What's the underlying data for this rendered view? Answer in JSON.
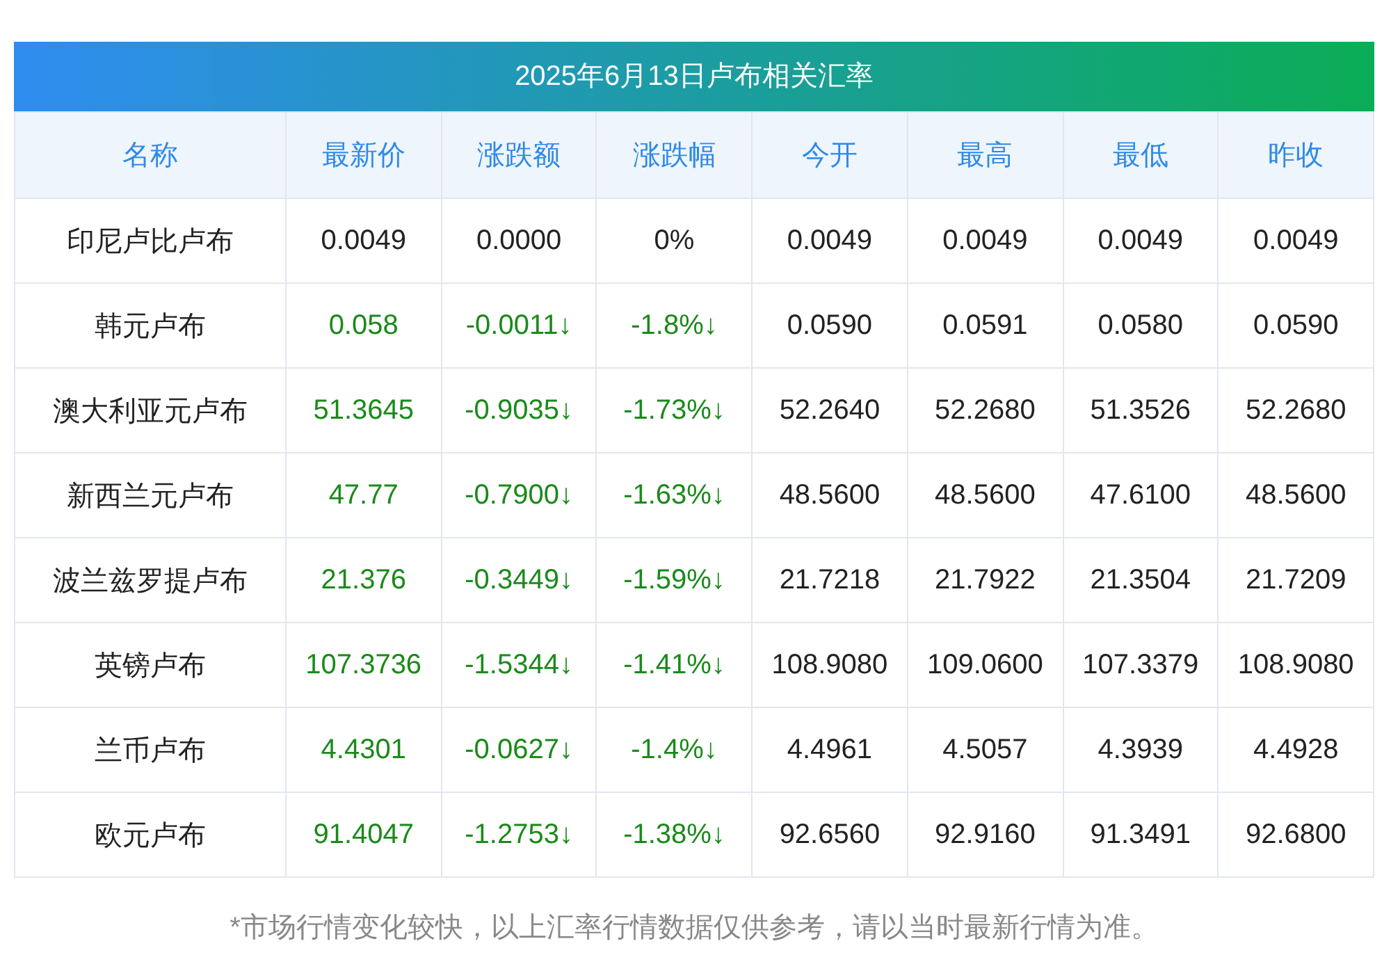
{
  "title": "2025年6月13日卢布相关汇率",
  "columns": [
    "名称",
    "最新价",
    "涨跌额",
    "涨跌幅",
    "今开",
    "最高",
    "最低",
    "昨收"
  ],
  "rows": [
    {
      "color": "#222222",
      "cells": [
        "印尼卢比卢布",
        "0.0049",
        "0.0000",
        "0%",
        "0.0049",
        "0.0049",
        "0.0049",
        "0.0049"
      ]
    },
    {
      "color": "#1a8a1a",
      "cells": [
        "韩元卢布",
        "0.058",
        "-0.0011↓",
        "-1.8%↓",
        "0.0590",
        "0.0591",
        "0.0580",
        "0.0590"
      ]
    },
    {
      "color": "#1a8a1a",
      "cells": [
        "澳大利亚元卢布",
        "51.3645",
        "-0.9035↓",
        "-1.73%↓",
        "52.2640",
        "52.2680",
        "51.3526",
        "52.2680"
      ]
    },
    {
      "color": "#1a8a1a",
      "cells": [
        "新西兰元卢布",
        "47.77",
        "-0.7900↓",
        "-1.63%↓",
        "48.5600",
        "48.5600",
        "47.6100",
        "48.5600"
      ]
    },
    {
      "color": "#1a8a1a",
      "cells": [
        "波兰兹罗提卢布",
        "21.376",
        "-0.3449↓",
        "-1.59%↓",
        "21.7218",
        "21.7922",
        "21.3504",
        "21.7209"
      ]
    },
    {
      "color": "#1a8a1a",
      "cells": [
        "英镑卢布",
        "107.3736",
        "-1.5344↓",
        "-1.41%↓",
        "108.9080",
        "109.0600",
        "107.3379",
        "108.9080"
      ]
    },
    {
      "color": "#1a8a1a",
      "cells": [
        "兰币卢布",
        "4.4301",
        "-0.0627↓",
        "-1.4%↓",
        "4.4961",
        "4.5057",
        "4.3939",
        "4.4928"
      ]
    },
    {
      "color": "#1a8a1a",
      "cells": [
        "欧元卢布",
        "91.4047",
        "-1.2753↓",
        "-1.38%↓",
        "92.6560",
        "92.9160",
        "91.3491",
        "92.6800"
      ]
    }
  ],
  "note": "*市场行情变化较快，以上汇率行情数据仅供参考，请以当时最新行情为准。"
}
